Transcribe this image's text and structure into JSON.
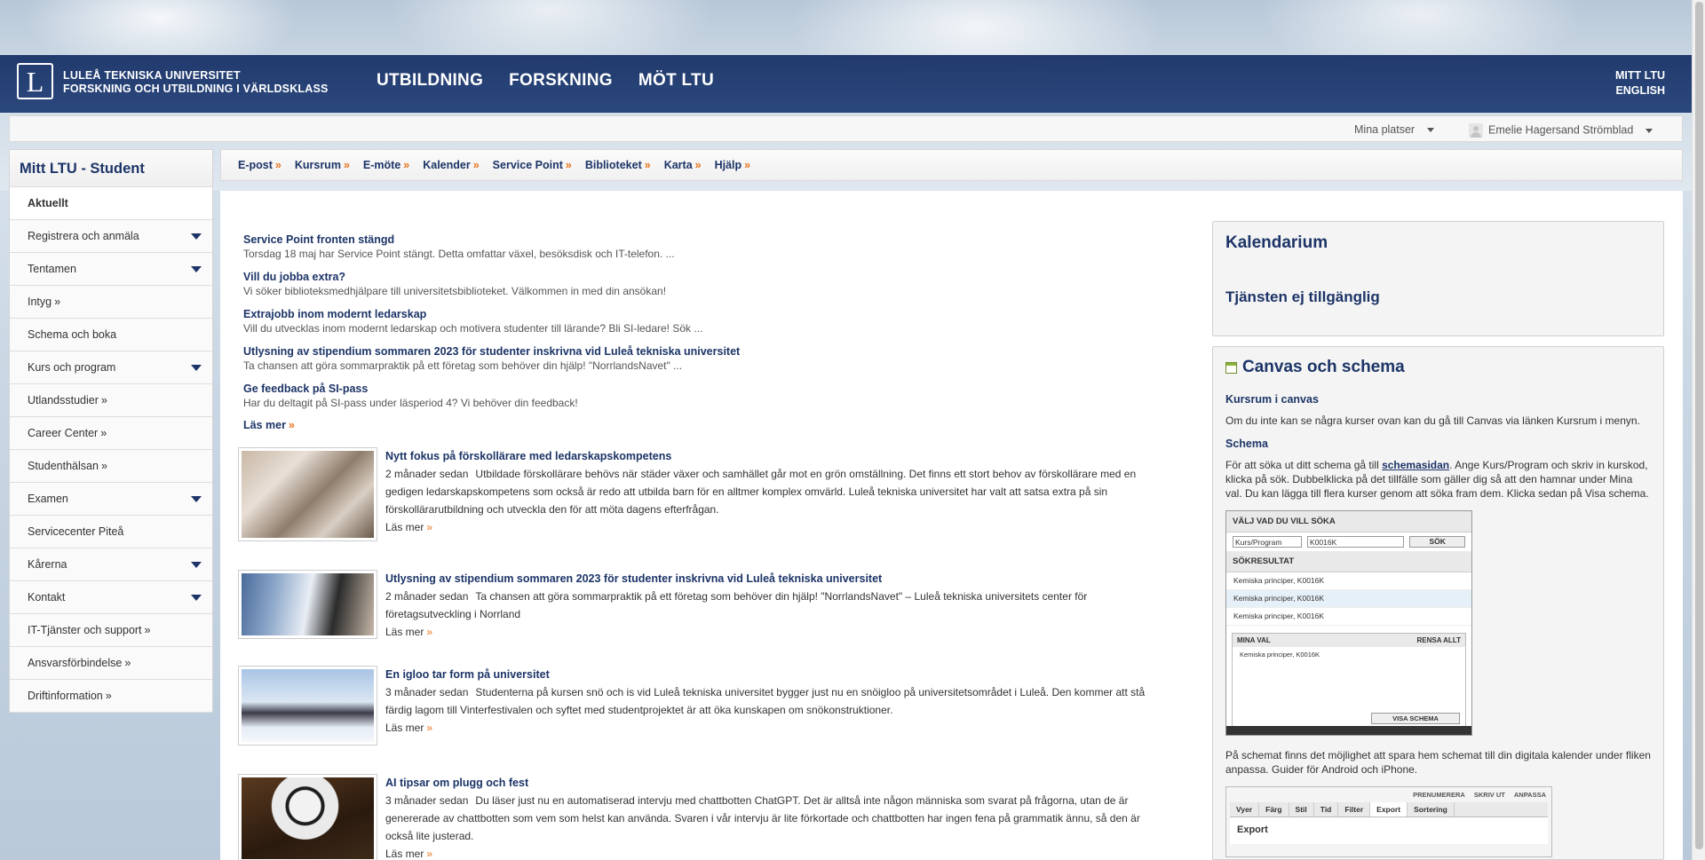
{
  "header": {
    "logo_letter": "L",
    "brand_line1": "LULEÅ TEKNISKA UNIVERSITET",
    "brand_line2": "FORSKNING OCH UTBILDNING I VÄRLDSKLASS",
    "nav": [
      "UTBILDNING",
      "FORSKNING",
      "MÖT LTU"
    ],
    "links": [
      "MITT LTU",
      "ENGLISH"
    ],
    "bar_color": "#1c3467"
  },
  "userbar": {
    "places": "Mina platser",
    "user": "Emelie Hagersand Strömblad"
  },
  "sidebar": {
    "title": "Mitt LTU - Student",
    "items": [
      {
        "label": "Aktuellt",
        "expand": false,
        "raquo": false
      },
      {
        "label": "Registrera och anmäla",
        "expand": true,
        "raquo": false
      },
      {
        "label": "Tentamen",
        "expand": true,
        "raquo": false
      },
      {
        "label": "Intyg",
        "expand": false,
        "raquo": true
      },
      {
        "label": "Schema och boka",
        "expand": false,
        "raquo": false
      },
      {
        "label": "Kurs och program",
        "expand": true,
        "raquo": false
      },
      {
        "label": "Utlandsstudier",
        "expand": false,
        "raquo": true
      },
      {
        "label": "Career Center",
        "expand": false,
        "raquo": true
      },
      {
        "label": "Studenthälsan",
        "expand": false,
        "raquo": true
      },
      {
        "label": "Examen",
        "expand": true,
        "raquo": false
      },
      {
        "label": "Servicecenter Piteå",
        "expand": false,
        "raquo": false
      },
      {
        "label": "Kårerna",
        "expand": true,
        "raquo": false
      },
      {
        "label": "Kontakt",
        "expand": true,
        "raquo": false
      },
      {
        "label": "IT-Tjänster och support",
        "expand": false,
        "raquo": true
      },
      {
        "label": "Ansvarsförbindelse",
        "expand": false,
        "raquo": true
      },
      {
        "label": "Driftinformation",
        "expand": false,
        "raquo": true
      }
    ]
  },
  "linkbar": [
    "E-post",
    "Kursrum",
    "E-möte",
    "Kalender",
    "Service Point",
    "Biblioteket",
    "Karta",
    "Hjälp"
  ],
  "news": [
    {
      "title": "Service Point fronten stängd",
      "desc": "Torsdag 18 maj har Service Point stängt. Detta omfattar växel, besöksdisk och IT-telefon. ..."
    },
    {
      "title": "Vill du jobba extra?",
      "desc": "Vi söker biblioteksmedhjälpare till universitetsbiblioteket. Välkommen in med din ansökan!"
    },
    {
      "title": "Extrajobb inom modernt ledarskap",
      "desc": "Vill du utvecklas inom modernt ledarskap och motivera studenter till lärande? Bli SI-ledare! Sök ..."
    },
    {
      "title": "Utlysning av stipendium sommaren 2023 för studenter inskrivna vid Luleå tekniska universitet",
      "desc": "Ta chansen att göra sommarpraktik på ett företag som behöver din hjälp! \"NorrlandsNavet\" ..."
    },
    {
      "title": "Ge feedback på SI-pass",
      "desc": "Har du deltagit på SI-pass under läsperiod 4? Vi behöver din feedback!"
    }
  ],
  "news_more": "Läs mer",
  "articles": [
    {
      "title": "Nytt fokus på förskollärare med ledarskapskompetens",
      "date": "2 månader sedan",
      "body": "Utbildade förskollärare behövs när städer växer och samhället går mot en grön omställning. Det finns ett stort behov av förskollärare med en gedigen ledarskapskompetens som också är redo att utbilda barn för en alltmer komplex omvärld. Luleå tekniska universitet har valt att satsa extra på sin förskollärarutbildning och utveckla den för att möta dagens efterfrågan.",
      "more": "Läs mer"
    },
    {
      "title": "Utlysning av stipendium sommaren 2023 för studenter inskrivna vid Luleå tekniska universitet",
      "date": "2 månader sedan",
      "body": "Ta chansen att göra sommarpraktik på ett företag som behöver din hjälp! \"NorrlandsNavet\" – Luleå tekniska universitets center för företagsutveckling i Norrland",
      "more": "Läs mer"
    },
    {
      "title": "En igloo tar form på universitet",
      "date": "3 månader sedan",
      "body": "Studenterna på kursen snö och is vid Luleå tekniska universitet bygger just nu en snöigloo på universitetsområdet i Luleå. Den kommer att stå färdig lagom till Vinterfestivalen och syftet med studentprojektet är att öka kunskapen om snökonstruktioner.",
      "more": "Läs mer"
    },
    {
      "title": "AI tipsar om plugg och fest",
      "date": "3 månader sedan",
      "body": "Du läser just nu en automatiserad intervju med chattbotten ChatGPT. Det är alltså inte någon människa som svarat på frågorna, utan de är genererade av chattbotten som vem som helst kan använda. Svaren i vår intervju är lite förkortade och chattbotten har ingen fena på grammatik ännu, så den är också lite justerad.",
      "more": "Läs mer"
    }
  ],
  "kalendarium": {
    "title": "Kalendarium",
    "message": "Tjänsten ej tillgänglig"
  },
  "canvas": {
    "title": "Canvas och schema",
    "sub1": "Kursrum i canvas",
    "p1": "Om du inte kan se några kurser ovan kan du gå till Canvas via länken Kursrum i menyn.",
    "sub2": "Schema",
    "p2_before": "För att söka ut ditt schema gå till ",
    "p2_link": "schemasidan",
    "p2_after": ". Ange Kurs/Program och skriv in kurskod, klicka på sök. Dubbelklicka på det tillfälle som gäller dig så att den hamnar under Mina val. Du kan lägga till flera kurser genom att söka fram dem. Klicka sedan på Visa schema.",
    "p3": "På schemat finns det möjlighet att spara hem schemat till din digitala kalender under fliken anpassa. Guider för Android och iPhone.",
    "shot": {
      "heading": "VÄLJ VAD DU VILL SÖKA",
      "select": "Kurs/Program",
      "input": "K0016K",
      "button": "SÖK",
      "results_heading": "SÖKRESULTAT",
      "results": [
        "Kemiska principer, K0016K",
        "Kemiska principer, K0016K",
        "Kemiska principer, K0016K"
      ],
      "mina_val": "MINA VAL",
      "rensa": "RENSA ALLT",
      "mina_item": "Kemiska principer, K0016K",
      "visa": "VISA SCHEMA"
    },
    "export": {
      "top": [
        "PRENUMERERA",
        "SKRIV UT",
        "ANPASSA"
      ],
      "tabs": [
        "Vyer",
        "Färg",
        "Stil",
        "Tid",
        "Filter",
        "Export",
        "Sortering"
      ],
      "label": "Export"
    }
  }
}
